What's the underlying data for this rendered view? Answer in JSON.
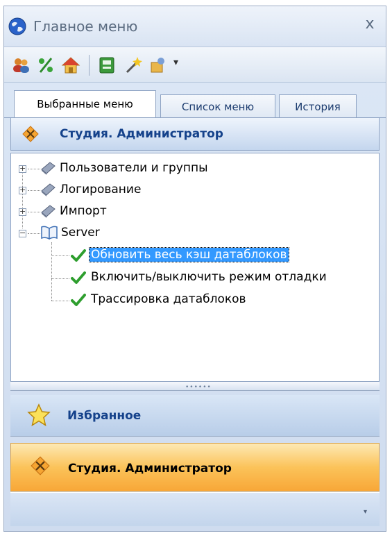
{
  "window": {
    "title": "Главное меню",
    "close_glyph": "x",
    "icon": "globe-icon"
  },
  "toolbar": {
    "buttons": [
      {
        "name": "users-icon"
      },
      {
        "name": "percent-icon"
      },
      {
        "name": "home-icon"
      },
      {
        "name": "screen-icon"
      },
      {
        "name": "wand-icon"
      },
      {
        "name": "share-icon"
      }
    ],
    "dropdown_glyph": "▾"
  },
  "tabs": [
    {
      "label": "Выбранные меню",
      "active": true
    },
    {
      "label": "Список меню",
      "active": false
    },
    {
      "label": "История",
      "active": false
    }
  ],
  "section_header": {
    "label": "Студия. Администратор",
    "icon": "tools-diamond-icon"
  },
  "tree": [
    {
      "label": "Пользователи и группы",
      "expander": "+",
      "icon": "book-icon"
    },
    {
      "label": "Логирование",
      "expander": "+",
      "icon": "book-icon"
    },
    {
      "label": "Импорт",
      "expander": "+",
      "icon": "book-icon"
    },
    {
      "label": "Server",
      "expander": "−",
      "icon": "open-book-icon"
    },
    {
      "label": "Обновить весь кэш датаблоков",
      "icon": "check-icon",
      "selected": true
    },
    {
      "label": "Включить/выключить режим отладки",
      "icon": "check-icon"
    },
    {
      "label": "Трассировка датаблоков",
      "icon": "check-icon"
    }
  ],
  "splitter_grip": "••••••",
  "nav": {
    "favorites": "Избранное",
    "admin": "Студия. Администратор"
  },
  "bottom_arrow": "▾",
  "colors": {
    "accent_blue": "#15428b",
    "selection": "#3399ff",
    "check_green": "#2e9e2e",
    "active_orange": "#f8a738"
  }
}
